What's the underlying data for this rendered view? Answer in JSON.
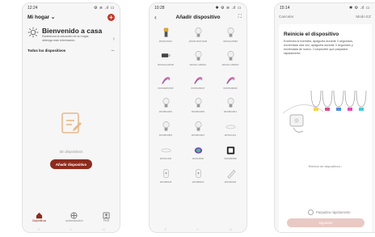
{
  "phone1": {
    "status_time": "12:24",
    "status_icons": "⚙ ≋ .ıl ▭",
    "home_selector": "Mi hogar",
    "welcome_title": "Bienvenido a casa",
    "welcome_subtitle": "Establezca la ubicación de su hogar, obtenga más información.",
    "devices_header": "Todos los dispositivos",
    "devices_more": "···",
    "empty_text": "Sin dispositivos",
    "add_button": "Añadir dispositivo",
    "tabs": [
      {
        "label": "Dispositivos",
        "icon": "home-icon"
      },
      {
        "label": "automatización",
        "icon": "automation-icon"
      },
      {
        "label": "Perfil",
        "icon": "profile-icon"
      }
    ]
  },
  "phone2": {
    "status_time": "10:28",
    "status_icons": "✱ ⚙ ≋ .ıl ▭",
    "title": "Añadir dispositivo",
    "devices": [
      {
        "label": "WOOHT301C",
        "icon": "lamp-icon"
      },
      {
        "label": "WOOHT301T-RGB",
        "icon": "bulb-icon"
      },
      {
        "label": "WOOHC2005Z",
        "icon": "bulb-icon"
      },
      {
        "label": "WOOHCG4001D",
        "icon": "spotlight-icon"
      },
      {
        "label": "WOOHC-LB001/1",
        "icon": "bulb-icon"
      },
      {
        "label": "WOOHC-LB002/3",
        "icon": "bulb-icon"
      },
      {
        "label": "WOOLEDSTRIP",
        "icon": "strip-icon"
      },
      {
        "label": "WOOSLB3017",
        "icon": "strip-icon"
      },
      {
        "label": "WOOSLB3006",
        "icon": "strip-icon"
      },
      {
        "label": "WOOBULB01",
        "icon": "bulb-icon"
      },
      {
        "label": "WOOBULB03",
        "icon": "bulb-icon"
      },
      {
        "label": "WOOBULB12",
        "icon": "bulb-icon"
      },
      {
        "label": "WOOBULB15",
        "icon": "bulb-icon"
      },
      {
        "label": "WOOBULB14",
        "icon": "bulb-icon"
      },
      {
        "label": "WOOCL001",
        "icon": "ceiling-icon"
      },
      {
        "label": "WOOCL003",
        "icon": "ceiling-icon"
      },
      {
        "label": "WOOLP002",
        "icon": "panel-icon"
      },
      {
        "label": "WOOWP008",
        "icon": "socket-icon"
      },
      {
        "label": "WOOBP018",
        "icon": "plug-icon"
      },
      {
        "label": "WOOBP019",
        "icon": "plug-icon"
      },
      {
        "label": "WOORF025",
        "icon": "remote-icon"
      }
    ]
  },
  "phone3": {
    "status_time": "15:14",
    "status_icons": "✱ ⚙ .ıl ▭",
    "cancel": "Cancelar",
    "mode": "Modo EZ",
    "title": "Reinicie el dispositivo",
    "description": "Encienda la bombilla, apáguela durante 3 segundos, enciéndala otra vez, apáguela durante 3 segundos y enciéndala de nuevo. Compruebe que parpadea rápidamente.",
    "reset_link": "Reinicio de dispositivos",
    "checkbox_label": "Parpadea rápidamente",
    "next_button": "Siguiente"
  },
  "colors": {
    "accent": "#8e2b1d",
    "plus": "#c0392b",
    "disabled_button": "#e9c9c3"
  }
}
